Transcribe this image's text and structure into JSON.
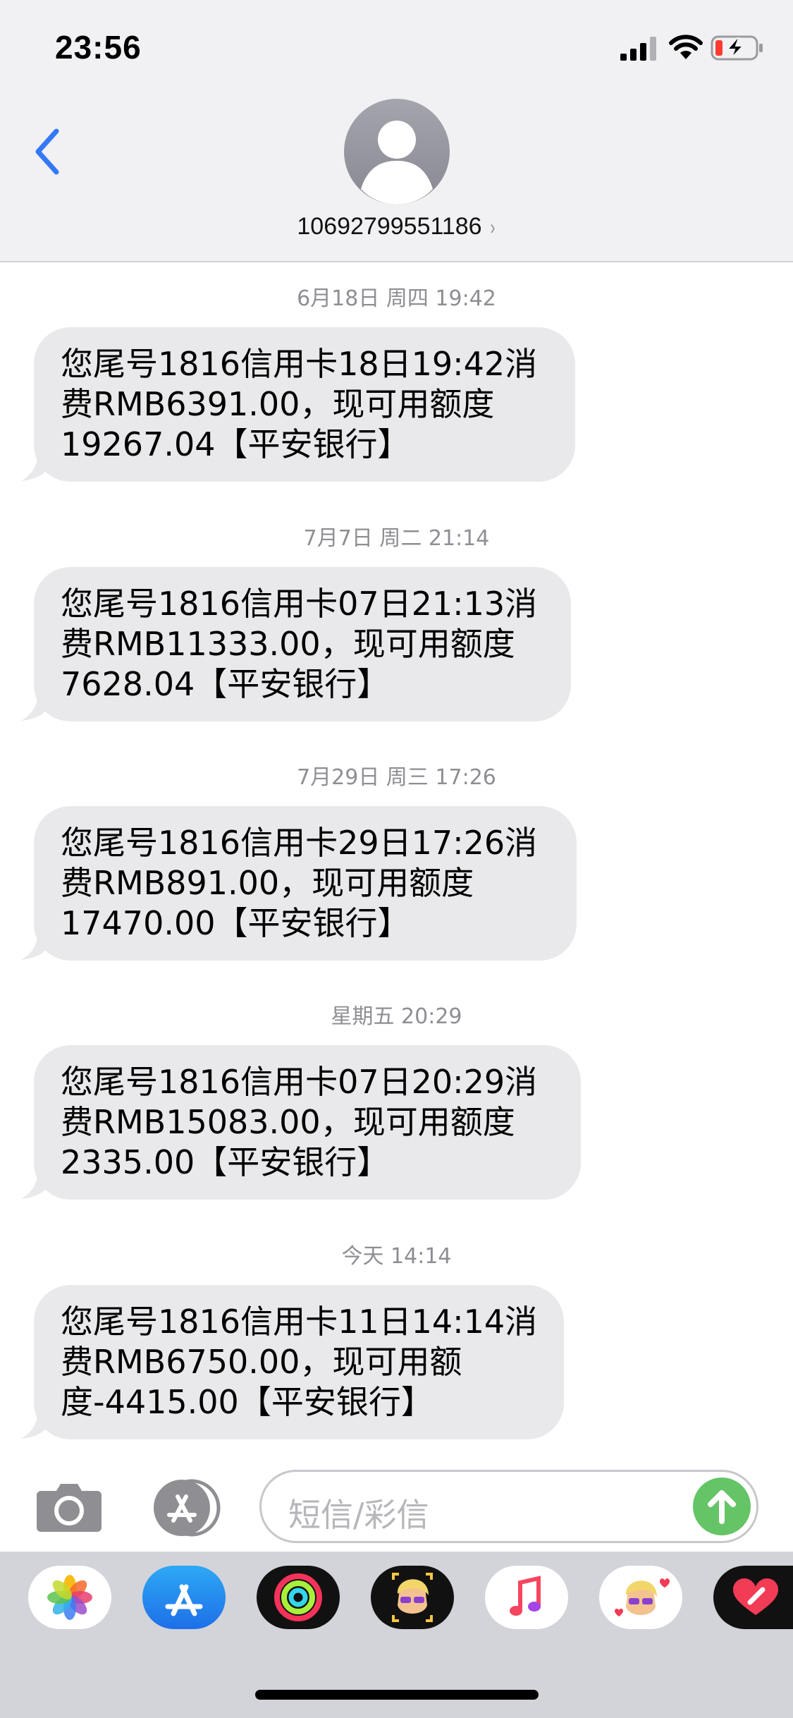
{
  "status_bar": {
    "time": "23:56"
  },
  "header": {
    "contact_number": "10692799551186",
    "contact_chevron": "›"
  },
  "messages": [
    {
      "timestamp": "6月18日 周四 19:42",
      "lines": [
        "您尾号1816信用卡18日19:42消",
        "费RMB6391.00，现可用额度",
        "19267.04【平安银行】"
      ]
    },
    {
      "timestamp": "7月7日 周二 21:14",
      "lines": [
        "您尾号1816信用卡07日21:13消",
        "费RMB11333.00，现可用额度",
        "7628.04【平安银行】"
      ]
    },
    {
      "timestamp": "7月29日 周三 17:26",
      "lines": [
        "您尾号1816信用卡29日17:26消",
        "费RMB891.00，现可用额度",
        "17470.00【平安银行】"
      ]
    },
    {
      "timestamp": "星期五 20:29",
      "lines": [
        "您尾号1816信用卡07日20:29消",
        "费RMB15083.00，现可用额度",
        "2335.00【平安银行】"
      ]
    },
    {
      "timestamp": "今天 14:14",
      "lines": [
        "您尾号1816信用卡11日14:14消",
        "费RMB6750.00，现可用额",
        "度-4415.00【平安银行】"
      ]
    }
  ],
  "composer": {
    "placeholder": "短信/彩信"
  },
  "app_drawer": {
    "apps": [
      "photos-icon",
      "app-store-icon",
      "activity-icon",
      "memoji-icon",
      "music-icon",
      "memoji-stickers-icon",
      "digital-touch-icon"
    ]
  },
  "colors": {
    "accent_blue": "#3478f6",
    "bubble_gray": "#e9e9eb",
    "send_green": "#65c466",
    "header_bg": "#f1f1f3",
    "battery_low_red": "#ff3b30"
  }
}
